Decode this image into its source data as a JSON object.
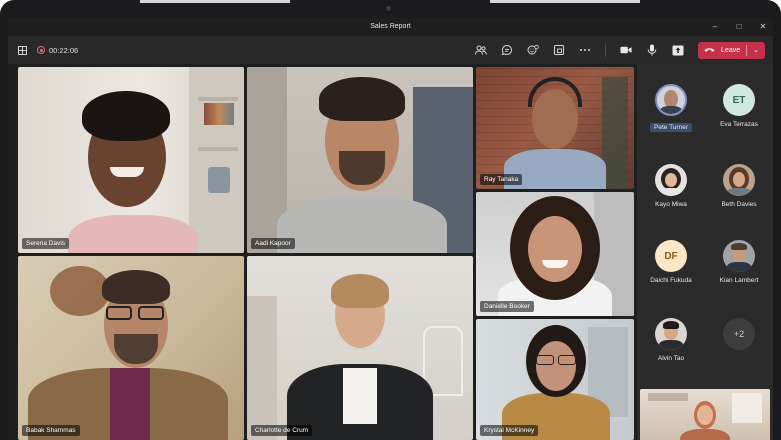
{
  "window": {
    "title": "Sales Report",
    "controls": [
      "–",
      "□",
      "✕"
    ]
  },
  "toolbar": {
    "timer": "00:22:06",
    "leave_label": "Leave",
    "icons": [
      "people-icon",
      "chat-icon",
      "reactions-icon",
      "rooms-icon",
      "more-icon",
      "camera-icon",
      "mic-icon",
      "share-icon"
    ],
    "leave_color": "#c4314b"
  },
  "tiles": [
    {
      "name": "Serena Davis"
    },
    {
      "name": "Aadi Kapoor"
    },
    {
      "name": "Ray Tanaka"
    },
    {
      "name": "Danielle Booker"
    },
    {
      "name": "Babak Shammas"
    },
    {
      "name": "Charlotte de Crum"
    },
    {
      "name": "Krystal McKinney"
    }
  ],
  "roster": [
    {
      "name": "Pete Turner",
      "active": true
    },
    {
      "name": "Eva Terrazas",
      "initials": "ET"
    },
    {
      "name": "Kayo Miwa"
    },
    {
      "name": "Beth Davies"
    },
    {
      "name": "Daichi Fukuda",
      "initials": "DF"
    },
    {
      "name": "Kian Lambert"
    },
    {
      "name": "Alvin Tao"
    },
    {
      "more": "+2"
    }
  ]
}
